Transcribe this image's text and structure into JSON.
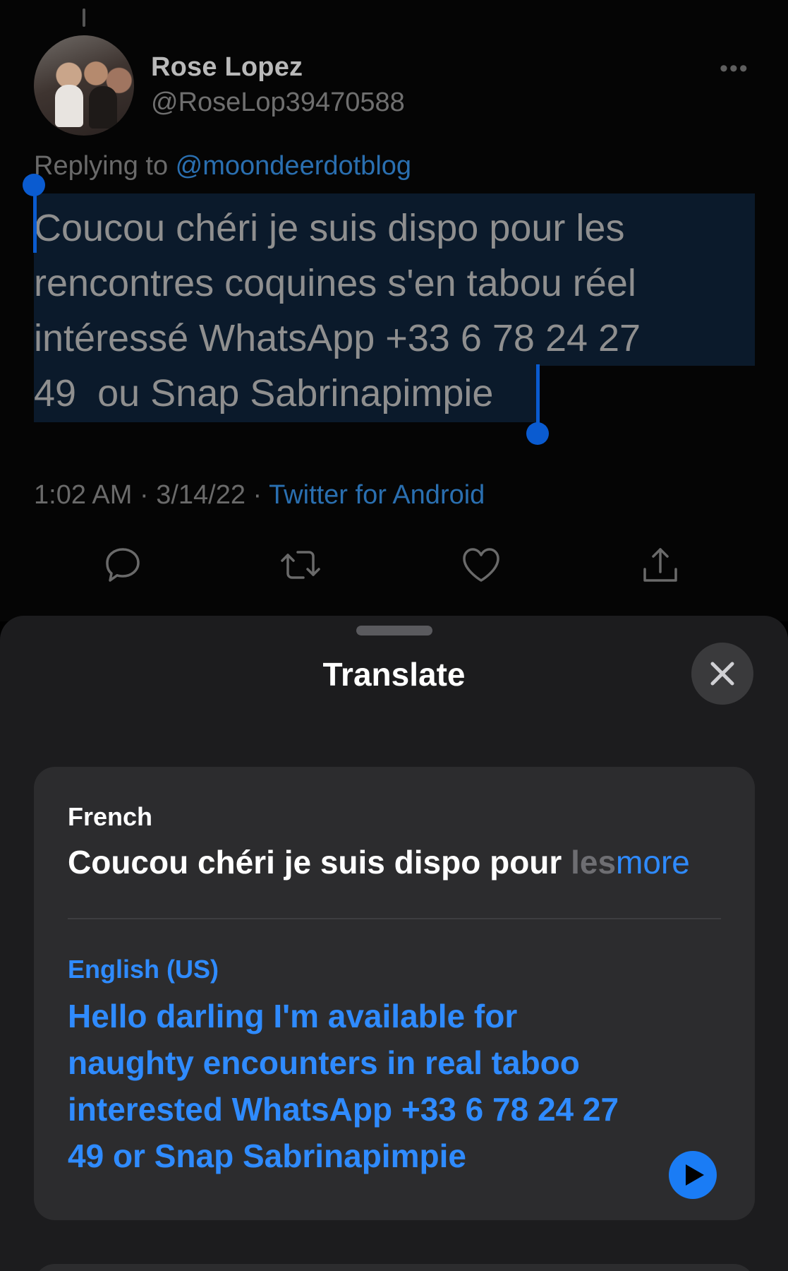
{
  "tweet": {
    "display_name": "Rose Lopez",
    "handle": "@RoseLop39470588",
    "replying_prefix": "Replying to ",
    "replying_to": "@moondeerdotblog",
    "text": "Coucou chéri je suis dispo pour les\nrencontres coquines s'en tabou réel\nintéressé WhatsApp +33 6 78 24 27\n49  ou Snap Sabrinapimpie",
    "timestamp": "1:02 AM · 3/14/22 · ",
    "source": "Twitter for Android",
    "more_icon": "ellipsis-icon",
    "actions": [
      "reply-icon",
      "retweet-icon",
      "like-icon",
      "share-icon"
    ]
  },
  "translate": {
    "title": "Translate",
    "source_language": "French",
    "source_text": "Coucou chéri je suis dispo pour ",
    "source_fade": "les",
    "more_label": "more",
    "target_language": "English (US)",
    "target_text": "Hello darling I'm available for naughty encounters in real taboo interested WhatsApp +33 6 78 24 27 49 or Snap Sabrinapimpie"
  },
  "colors": {
    "accent": "#2f8bff",
    "selection": "#0a5bd0",
    "sheet_bg": "#1c1c1e",
    "card_bg": "#2c2c2e"
  }
}
